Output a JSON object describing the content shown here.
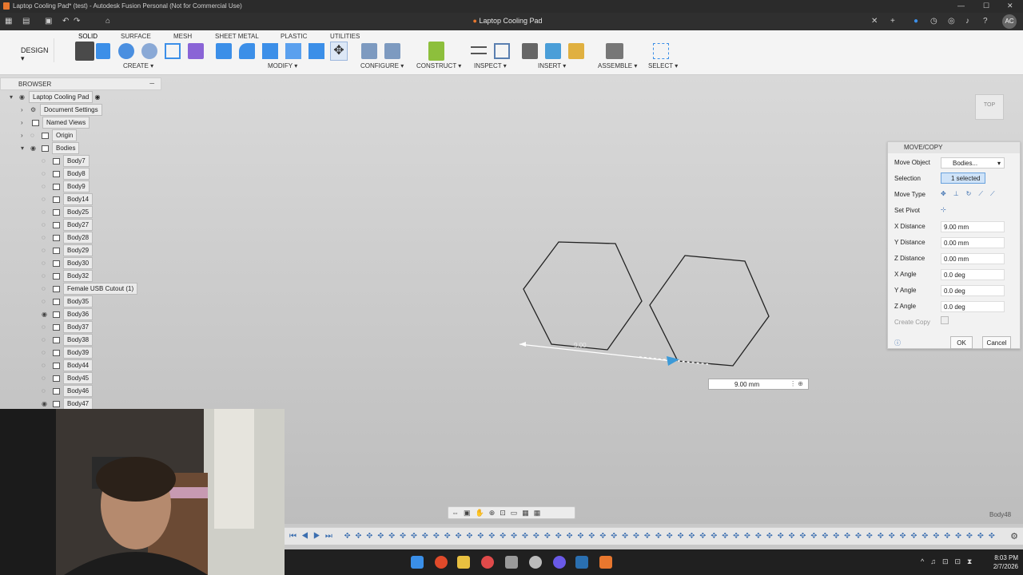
{
  "window": {
    "title": "Laptop Cooling Pad* (test) - Autodesk Fusion Personal (Not for Commercial Use)"
  },
  "doc_tab": {
    "name": "Laptop Cooling Pad"
  },
  "user_initials": "AC",
  "toolbar": {
    "workspace": "DESIGN",
    "tabs": [
      "SOLID",
      "SURFACE",
      "MESH",
      "SHEET METAL",
      "PLASTIC",
      "UTILITIES"
    ],
    "groups": [
      "CREATE",
      "MODIFY",
      "CONFIGURE",
      "CONSTRUCT",
      "INSPECT",
      "INSERT",
      "ASSEMBLE",
      "SELECT"
    ]
  },
  "browser": {
    "title": "BROWSER",
    "root": "Laptop Cooling Pad",
    "top_items": [
      "Document Settings",
      "Named Views",
      "Origin",
      "Bodies"
    ],
    "bodies": [
      "Body7",
      "Body8",
      "Body9",
      "Body14",
      "Body25",
      "Body27",
      "Body28",
      "Body29",
      "Body30",
      "Body32",
      "Female USB Cutout (1)",
      "Body35",
      "Body36",
      "Body37",
      "Body38",
      "Body39",
      "Body44",
      "Body45",
      "Body46",
      "Body47"
    ]
  },
  "view_cube": {
    "face": "TOP"
  },
  "move_panel": {
    "title": "MOVE/COPY",
    "move_object_label": "Move Object",
    "move_object_value": "Bodies...",
    "selection_label": "Selection",
    "selection_value": "1 selected",
    "move_type_label": "Move Type",
    "set_pivot_label": "Set Pivot",
    "fields": [
      {
        "label": "X Distance",
        "value": "9.00 mm"
      },
      {
        "label": "Y Distance",
        "value": "0.00 mm"
      },
      {
        "label": "Z Distance",
        "value": "0.00 mm"
      },
      {
        "label": "X Angle",
        "value": "0.0 deg"
      },
      {
        "label": "Y Angle",
        "value": "0.0 deg"
      },
      {
        "label": "Z Angle",
        "value": "0.0 deg"
      }
    ],
    "create_copy_label": "Create Copy",
    "ok": "OK",
    "cancel": "Cancel"
  },
  "canvas": {
    "drag_value": "9.00 mm",
    "ghost_dim": "9.00",
    "hover_body": "Body48"
  },
  "taskbar": {
    "time": "8:03 PM",
    "date": "2/7/2026"
  }
}
